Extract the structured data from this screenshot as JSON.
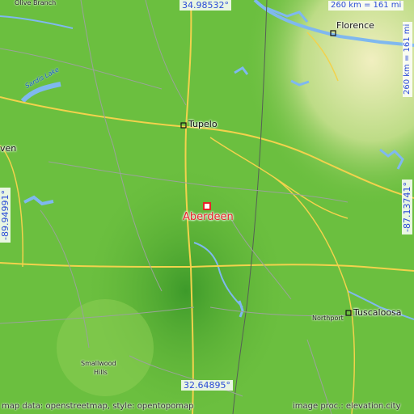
{
  "coords": {
    "top": "34.98532°",
    "bottom": "32.64895°",
    "left": "-89.94991°",
    "right": "-87.13741°"
  },
  "scale": {
    "horizontal": "260 km = 161 mi",
    "vertical": "260 km = 161 mi"
  },
  "places": {
    "main": "Aberdeen",
    "cities": [
      "Florence",
      "Tupelo",
      "Tuscaloosa",
      "Northport"
    ],
    "partial": [
      "Olive Branch",
      "ven"
    ],
    "smallwood": [
      "Smallwood",
      "Hills"
    ]
  },
  "water": {
    "sardis": "Sardis Lake"
  },
  "credits": {
    "left": "map data: openstreetmap, style: opentopomap",
    "right": "image proc.: elevation.city"
  },
  "colors": {
    "lowland": "#6bbf3f",
    "upland": "#e2e6a6",
    "water": "#7fb8ef",
    "road_major": "#f2d24c",
    "road_minor": "#9aa39a",
    "highlight": "#e8232a",
    "coord_text": "#2a4bd7"
  }
}
